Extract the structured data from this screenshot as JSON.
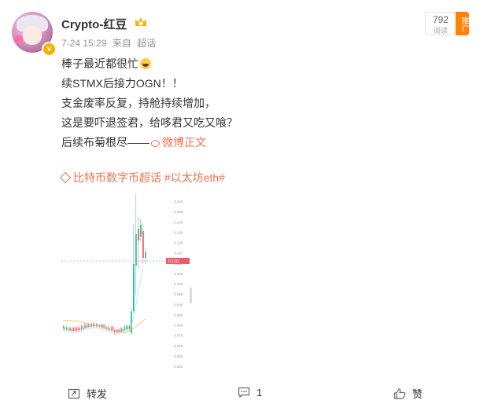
{
  "post": {
    "username": "Crypto-红豆",
    "time": "7-24 15:29",
    "source": "来自",
    "topic_tag": "超话",
    "views": "792",
    "views_label": "阅读",
    "push_label": "推广",
    "lines": [
      "棒子最近都很忙",
      "续STMX后接力OGN！！",
      "支金废率反复，持舱持续增加，",
      "这是要吓退签君，给哆君又吃又喰？",
      "后续布菊根尽——"
    ],
    "link_text": "微博正文",
    "topics": "比特币数字币超话 #以太坊eth#"
  },
  "chart_data": {
    "type": "candlestick",
    "price_labels": [
      "0.140",
      "0.135",
      "0.130",
      "0.125",
      "0.120",
      "0.115",
      "0.110",
      "0.105",
      "0.100",
      "0.095",
      "0.090",
      "0.085",
      "0.080",
      "0.075",
      "0.070",
      "0.065",
      "0.060"
    ],
    "current_price_label": "0.1111",
    "colors": {
      "up": "#26c6a2",
      "down": "#ef5b6a",
      "ma": "#f5b94b"
    }
  },
  "footer": {
    "repost_label": "转发",
    "comment_count": "1",
    "like_label": "赞"
  }
}
